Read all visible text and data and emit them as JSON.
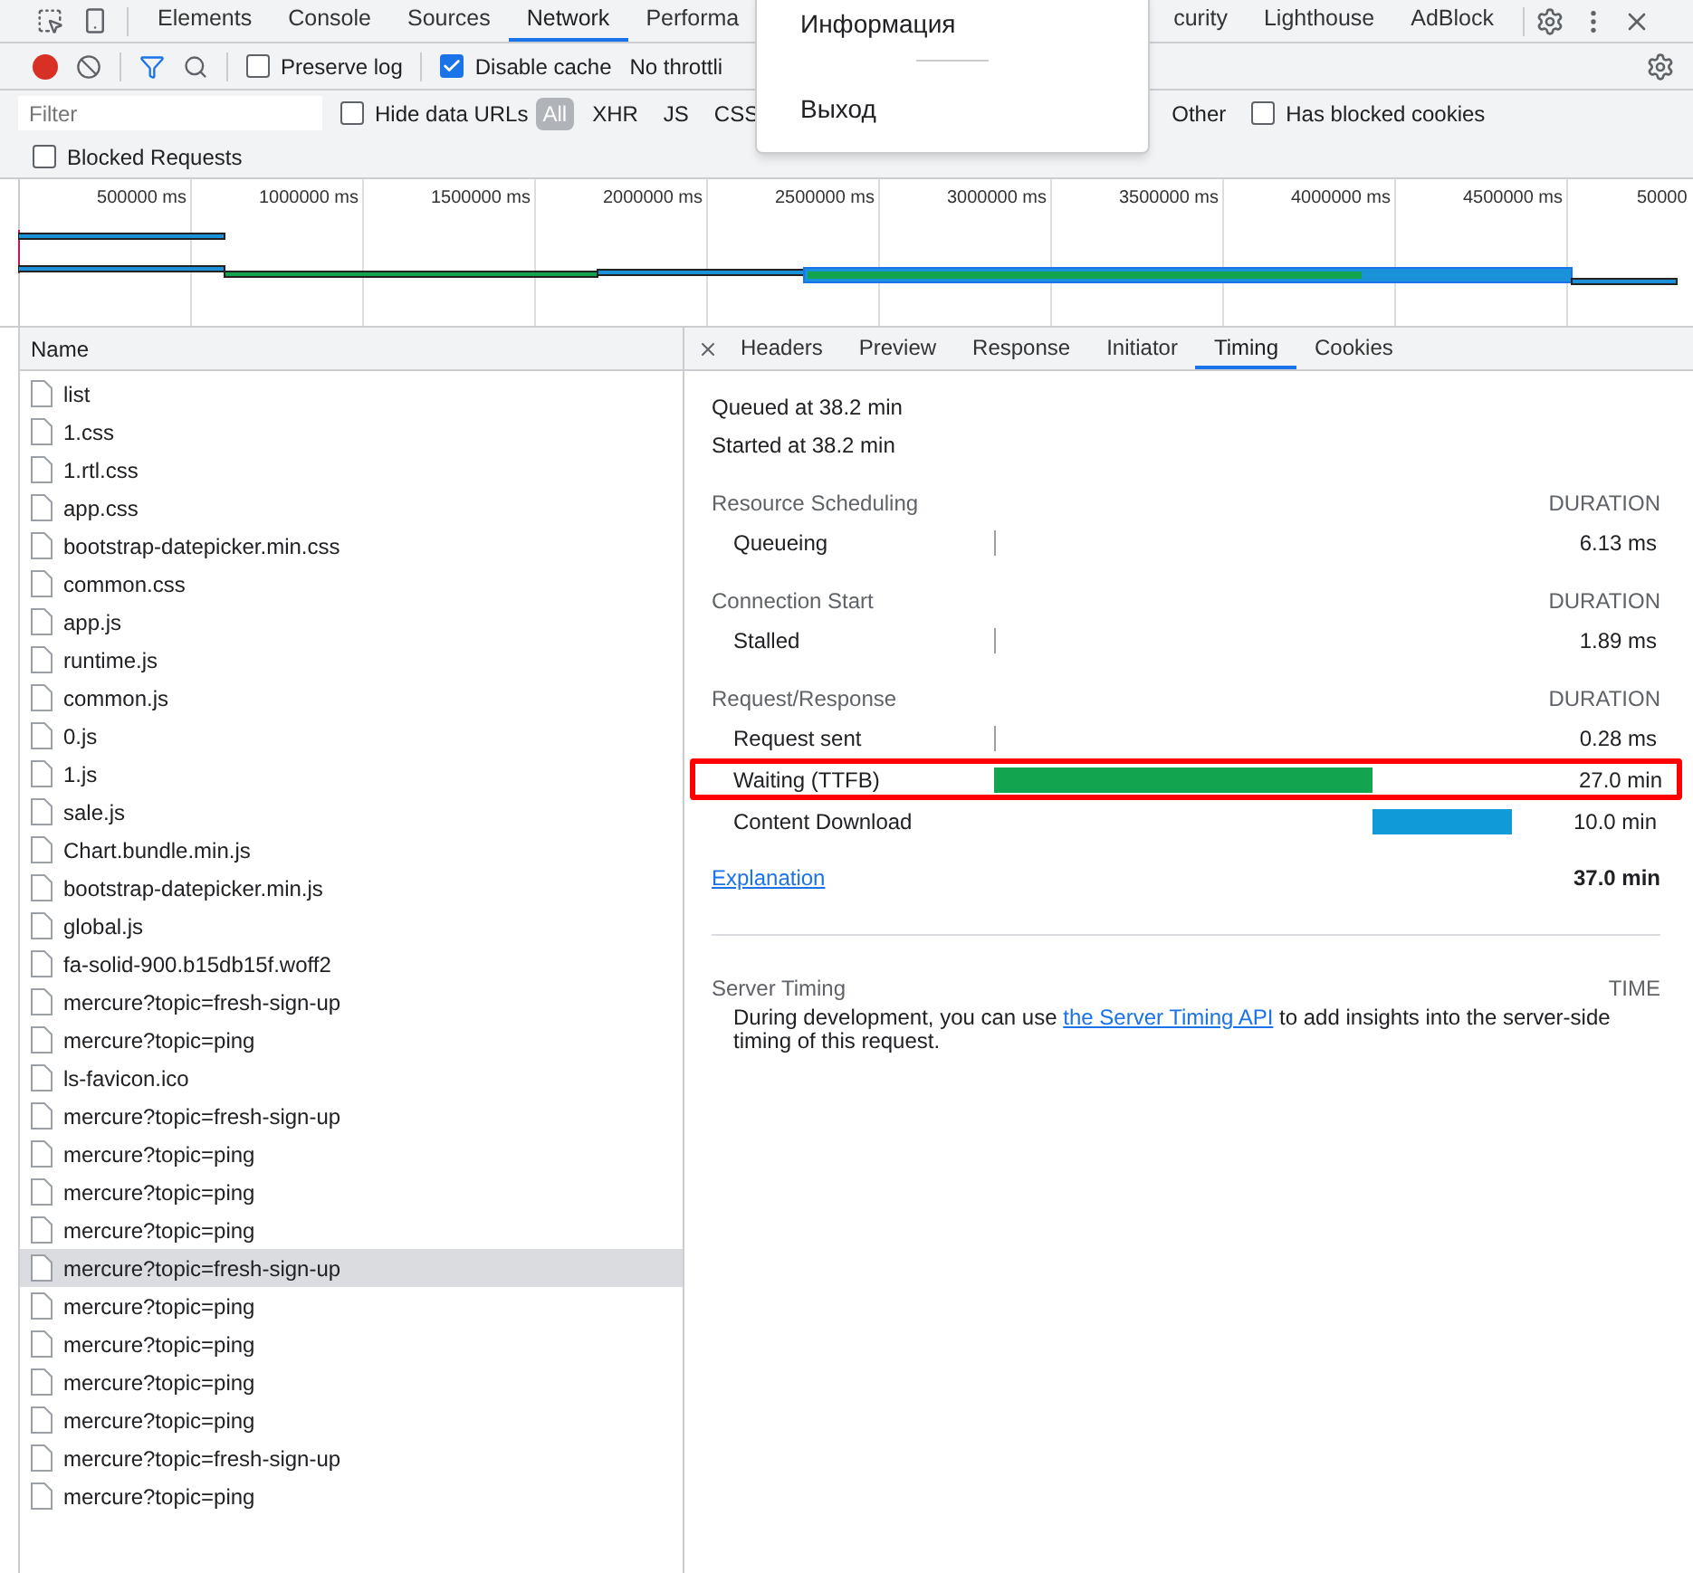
{
  "tabs": [
    {
      "label": "Elements",
      "selected": false
    },
    {
      "label": "Console",
      "selected": false
    },
    {
      "label": "Sources",
      "selected": false
    },
    {
      "label": "Network",
      "selected": true
    },
    {
      "label": "Performa",
      "selected": false
    }
  ],
  "tabs_after_menu": [
    {
      "label": "curity",
      "selected": false
    },
    {
      "label": "Lighthouse",
      "selected": false
    },
    {
      "label": "AdBlock",
      "selected": false
    }
  ],
  "menu": {
    "items": [
      "Информация",
      "Выход"
    ]
  },
  "toolbar": {
    "recording": true,
    "preserve_log": {
      "label": "Preserve log",
      "checked": false
    },
    "disable_cache": {
      "label": "Disable cache",
      "checked": true
    },
    "throttling": "No throttli"
  },
  "filter": {
    "placeholder": "Filter",
    "hide_data_urls": {
      "label": "Hide data URLs",
      "checked": false
    },
    "type_filters": [
      {
        "label": "All",
        "selected": true
      },
      {
        "label": "XHR",
        "selected": false
      },
      {
        "label": "JS",
        "selected": false
      },
      {
        "label": "CSS",
        "selected": false
      }
    ],
    "type_filters_after_menu": [
      {
        "label": "Other",
        "selected": false
      }
    ],
    "has_blocked_cookies": {
      "label": "Has blocked cookies",
      "checked": false
    },
    "blocked_requests": {
      "label": "Blocked Requests",
      "checked": false
    }
  },
  "overview": {
    "ticks": [
      "500000 ms",
      "1000000 ms",
      "1500000 ms",
      "2000000 ms",
      "2500000 ms",
      "3000000 ms",
      "3500000 ms",
      "4000000 ms",
      "4500000 ms",
      "50000"
    ]
  },
  "requests": {
    "column": "Name",
    "rows": [
      {
        "name": "list",
        "selected": false
      },
      {
        "name": "1.css",
        "selected": false
      },
      {
        "name": "1.rtl.css",
        "selected": false
      },
      {
        "name": "app.css",
        "selected": false
      },
      {
        "name": "bootstrap-datepicker.min.css",
        "selected": false
      },
      {
        "name": "common.css",
        "selected": false
      },
      {
        "name": "app.js",
        "selected": false
      },
      {
        "name": "runtime.js",
        "selected": false
      },
      {
        "name": "common.js",
        "selected": false
      },
      {
        "name": "0.js",
        "selected": false
      },
      {
        "name": "1.js",
        "selected": false
      },
      {
        "name": "sale.js",
        "selected": false
      },
      {
        "name": "Chart.bundle.min.js",
        "selected": false
      },
      {
        "name": "bootstrap-datepicker.min.js",
        "selected": false
      },
      {
        "name": "global.js",
        "selected": false
      },
      {
        "name": "fa-solid-900.b15db15f.woff2",
        "selected": false
      },
      {
        "name": "mercure?topic=fresh-sign-up",
        "selected": false
      },
      {
        "name": "mercure?topic=ping",
        "selected": false
      },
      {
        "name": "ls-favicon.ico",
        "selected": false
      },
      {
        "name": "mercure?topic=fresh-sign-up",
        "selected": false
      },
      {
        "name": "mercure?topic=ping",
        "selected": false
      },
      {
        "name": "mercure?topic=ping",
        "selected": false
      },
      {
        "name": "mercure?topic=ping",
        "selected": false
      },
      {
        "name": "mercure?topic=fresh-sign-up",
        "selected": true
      },
      {
        "name": "mercure?topic=ping",
        "selected": false
      },
      {
        "name": "mercure?topic=ping",
        "selected": false
      },
      {
        "name": "mercure?topic=ping",
        "selected": false
      },
      {
        "name": "mercure?topic=ping",
        "selected": false
      },
      {
        "name": "mercure?topic=fresh-sign-up",
        "selected": false
      },
      {
        "name": "mercure?topic=ping",
        "selected": false
      }
    ]
  },
  "detail_tabs": [
    {
      "label": "Headers",
      "selected": false
    },
    {
      "label": "Preview",
      "selected": false
    },
    {
      "label": "Response",
      "selected": false
    },
    {
      "label": "Initiator",
      "selected": false
    },
    {
      "label": "Timing",
      "selected": true
    },
    {
      "label": "Cookies",
      "selected": false
    }
  ],
  "timing": {
    "queued": "Queued at 38.2 min",
    "started": "Started at 38.2 min",
    "sections": [
      {
        "title": "Resource Scheduling",
        "column": "DURATION",
        "phases": [
          {
            "label": "Queueing",
            "kind": "tick",
            "value": "6.13 ms",
            "highlighted": false
          }
        ]
      },
      {
        "title": "Connection Start",
        "column": "DURATION",
        "phases": [
          {
            "label": "Stalled",
            "kind": "tick",
            "value": "1.89 ms",
            "highlighted": false
          }
        ]
      },
      {
        "title": "Request/Response",
        "column": "DURATION",
        "phases": [
          {
            "label": "Request sent",
            "kind": "tick",
            "value": "0.28 ms",
            "highlighted": false
          },
          {
            "label": "Waiting (TTFB)",
            "kind": "waiting",
            "value": "27.0 min",
            "highlighted": true
          },
          {
            "label": "Content Download",
            "kind": "download",
            "value": "10.0 min",
            "highlighted": false
          }
        ]
      }
    ],
    "explanation": "Explanation",
    "total": "37.0 min",
    "server_timing": {
      "title": "Server Timing",
      "column": "TIME",
      "text_before": "During development, you can use",
      "link": "the Server Timing API",
      "text_after": "to add insights into the server-side timing of this request."
    }
  }
}
